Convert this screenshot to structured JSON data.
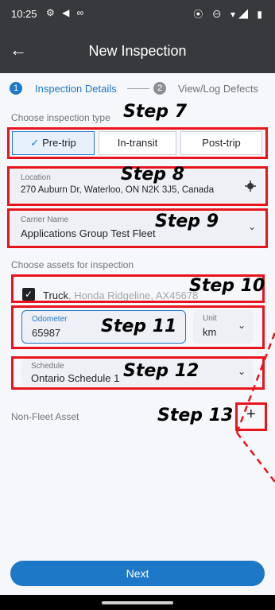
{
  "status_bar": {
    "time": "10:25",
    "left_icons": "⚙ ◀ ∞",
    "right_icons": "⦿ ⊖ ▾◢ ▮"
  },
  "app_bar": {
    "back_icon": "←",
    "title": "New Inspection"
  },
  "stepper": {
    "step1_number": "1",
    "step1_label": "Inspection Details",
    "step2_number": "2",
    "step2_label": "View/Log Defects"
  },
  "inspection_type": {
    "label": "Choose inspection type",
    "options": [
      "Pre-trip",
      "In-transit",
      "Post-trip"
    ],
    "selected": "Pre-trip",
    "check_icon": "✓"
  },
  "location": {
    "label": "Location",
    "value": "270 Auburn Dr, Waterloo, ON N2K 3J5, Canada",
    "icon": "target-icon"
  },
  "carrier": {
    "label": "Carrier Name",
    "value": "Applications Group Test Fleet"
  },
  "assets": {
    "label": "Choose assets for inspection",
    "truck_name": "Truck",
    "truck_detail": ", Honda Ridgeline, AX45678",
    "checked": true
  },
  "odometer": {
    "label": "Odometer",
    "value": "65987"
  },
  "unit": {
    "label": "Unit",
    "value": "km"
  },
  "schedule": {
    "label": "Schedule",
    "value": "Ontario Schedule 1"
  },
  "non_fleet": {
    "label": "Non-Fleet Asset",
    "add_icon": "+"
  },
  "annotations": {
    "step7": "Step 7",
    "step8": "Step 8",
    "step9": "Step 9",
    "step10": "Step 10",
    "step11": "Step 11",
    "step12": "Step 12",
    "step13": "Step 13"
  },
  "next_button": "Next",
  "colors": {
    "accent": "#1e78c8",
    "annotation_red": "#e8141c",
    "app_bar": "#37393d"
  }
}
